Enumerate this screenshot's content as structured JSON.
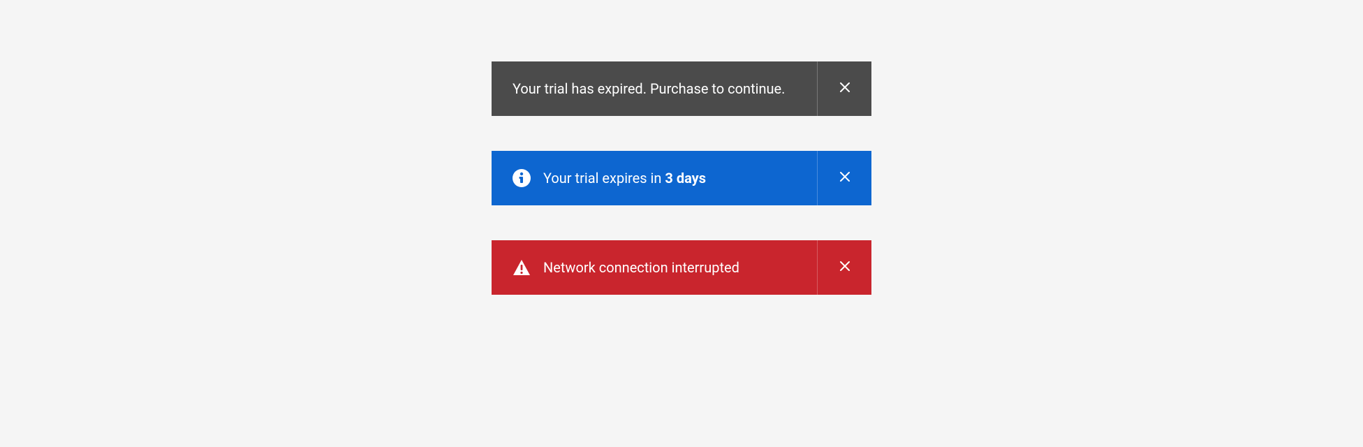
{
  "alerts": {
    "neutral": {
      "message": "Your trial has expired. Purchase to continue."
    },
    "info": {
      "message_prefix": "Your trial expires in ",
      "message_bold": "3 days"
    },
    "negative": {
      "message": "Network connection interrupted"
    }
  }
}
